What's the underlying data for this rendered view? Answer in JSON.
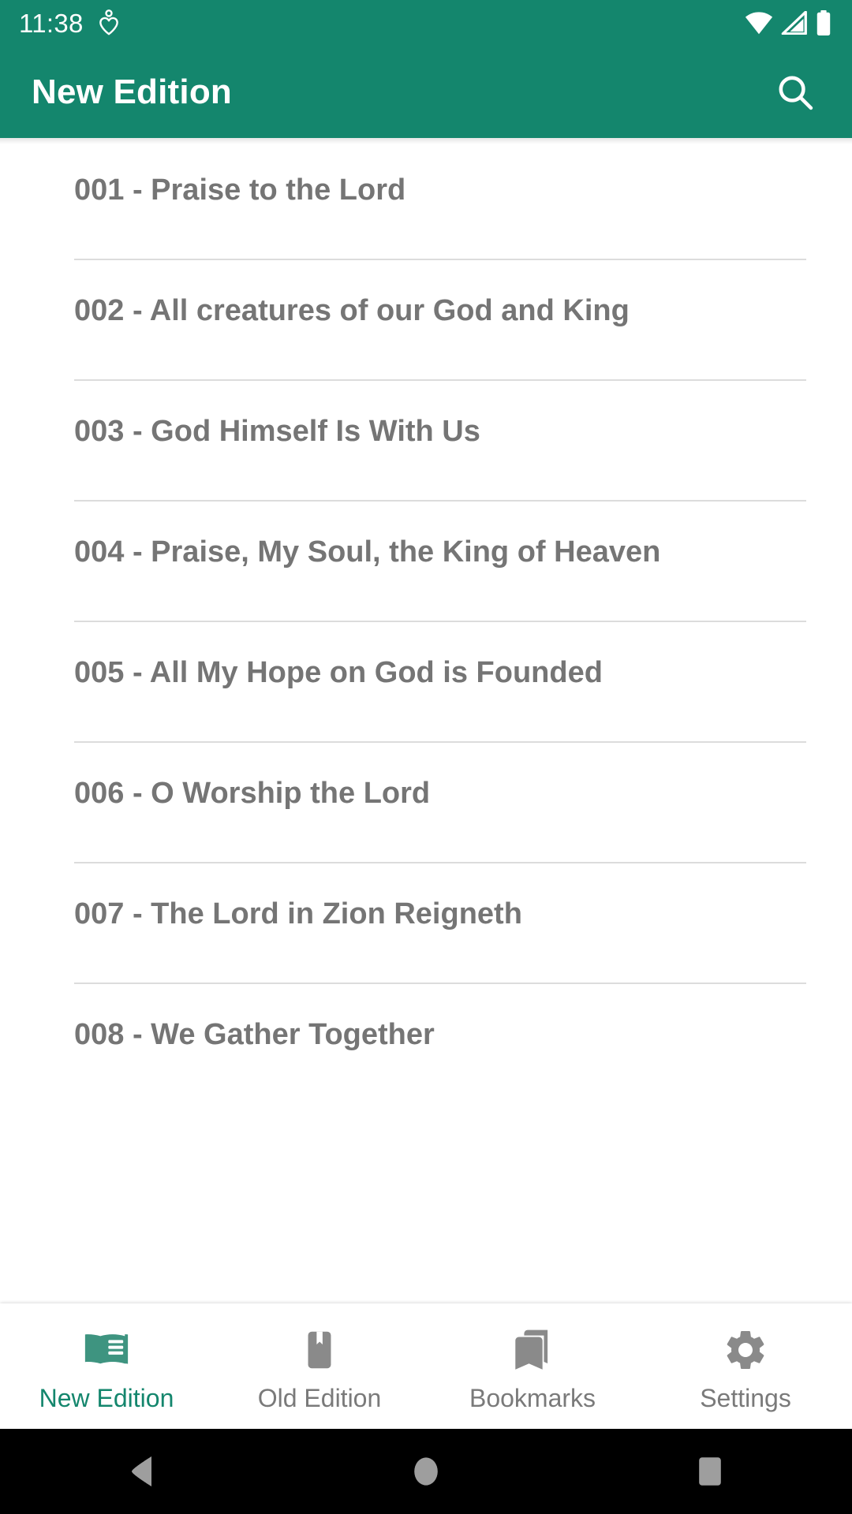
{
  "status_bar": {
    "time": "11:38",
    "notification_icon": "heart-notification-icon",
    "wifi_icon": "wifi-icon",
    "signal_icon": "cellular-signal-icon",
    "battery_icon": "battery-full-icon",
    "background_color": "#14866D"
  },
  "app_bar": {
    "title": "New Edition",
    "search_icon": "search-icon",
    "background_color": "#14866D",
    "text_color": "#FFFFFF"
  },
  "list": {
    "items": [
      {
        "label": "001 - Praise to the Lord"
      },
      {
        "label": "002 - All creatures of our God and King"
      },
      {
        "label": "003 - God Himself Is With Us"
      },
      {
        "label": "004 - Praise, My Soul, the King of Heaven"
      },
      {
        "label": "005 - All My Hope on God is Founded"
      },
      {
        "label": "006 - O Worship the Lord"
      },
      {
        "label": "007 - The Lord in Zion Reigneth"
      },
      {
        "label": "008 - We Gather Together"
      }
    ],
    "text_color": "#757575",
    "divider_color": "#DCDCDC"
  },
  "bottom_nav": {
    "active_color": "#14866D",
    "inactive_color": "#7A7A7A",
    "items": [
      {
        "label": "New Edition",
        "icon": "open-book-icon",
        "active": true
      },
      {
        "label": "Old Edition",
        "icon": "closed-book-bookmark-icon",
        "active": false
      },
      {
        "label": "Bookmarks",
        "icon": "bookmarks-icon",
        "active": false
      },
      {
        "label": "Settings",
        "icon": "gear-icon",
        "active": false
      }
    ]
  },
  "system_nav": {
    "back_icon": "back-triangle-icon",
    "home_icon": "home-circle-icon",
    "recents_icon": "recents-square-icon",
    "background_color": "#000000",
    "icon_color": "#9E9E9E"
  }
}
